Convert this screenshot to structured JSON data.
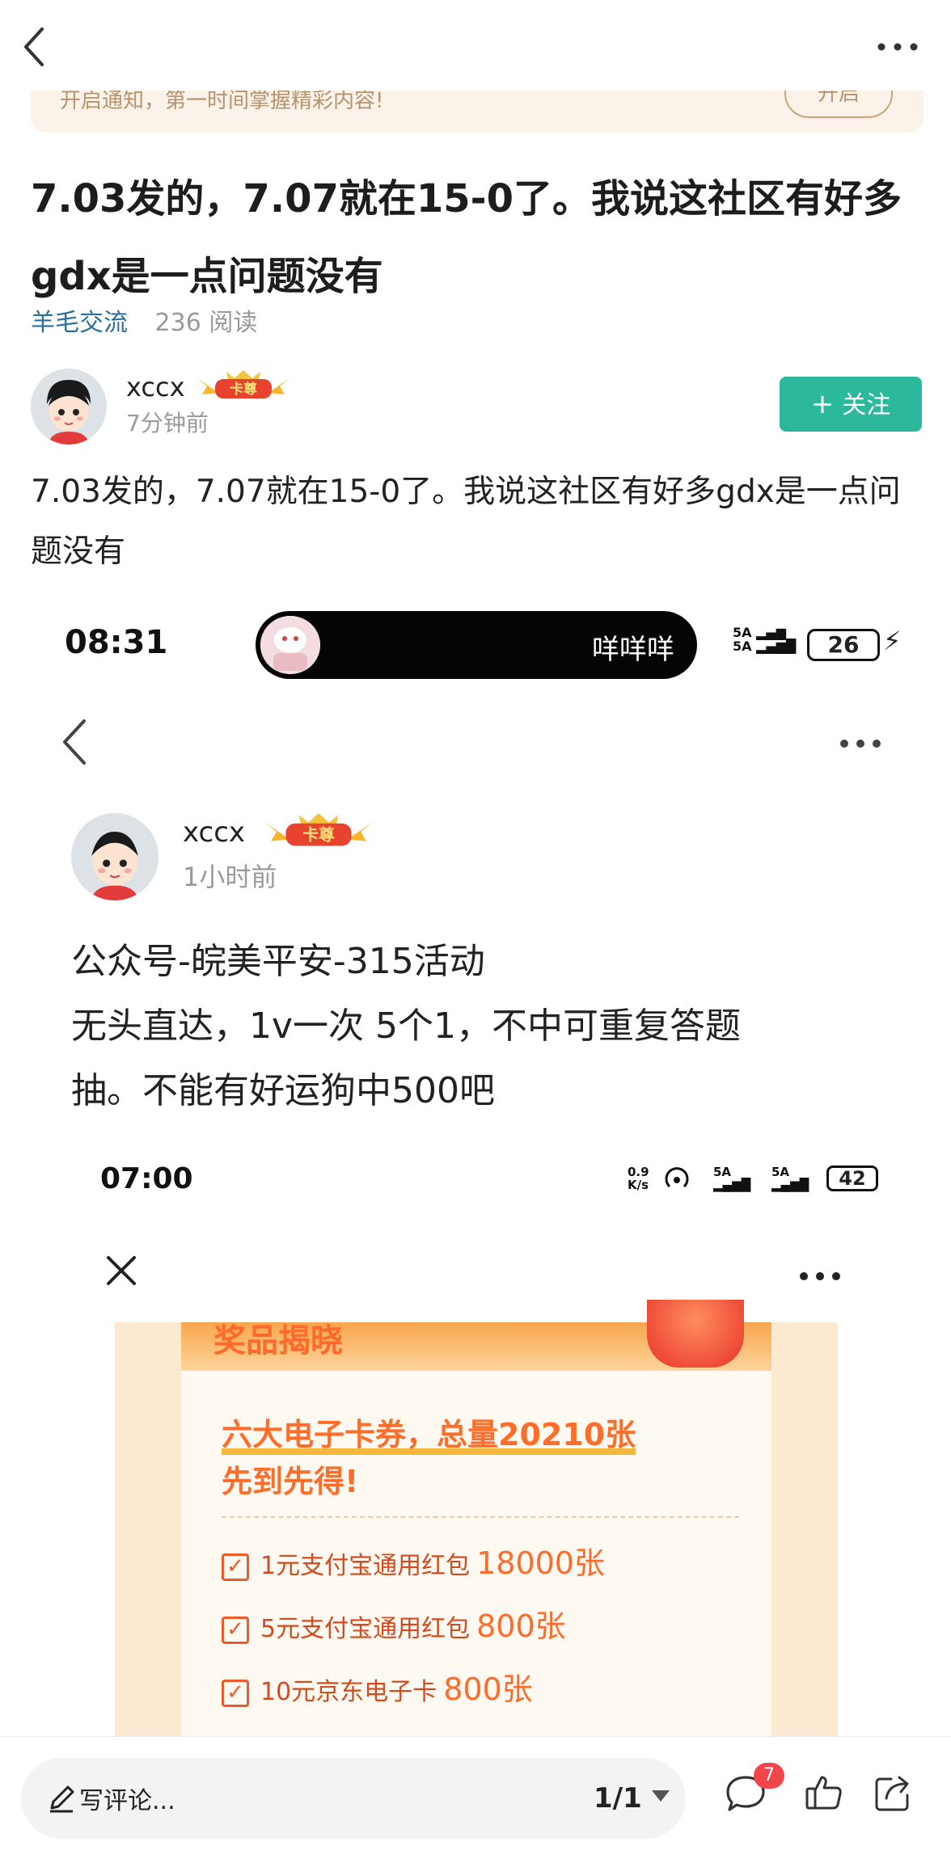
{
  "nav": {
    "back_icon": "back-arrow-icon",
    "more_icon": "more-dots-icon"
  },
  "notify": {
    "text": "开启通知，第一时间掌握精彩内容!",
    "button": "开启"
  },
  "post": {
    "title": "7.03发的，7.07就在15-0了。我说这社区有好多gdx是一点问题没有",
    "category": "羊毛交流",
    "reads": "236 阅读",
    "author": {
      "name": "xccx",
      "badge": "卡尊",
      "time": "7分钟前"
    },
    "follow": {
      "label": "关注",
      "plus": "+"
    },
    "body": "7.03发的，7.07就在15-0了。我说这社区有好多gdx是一点问题没有"
  },
  "shot": {
    "status": {
      "time": "08:31",
      "live_text": "咩咩咩",
      "signal_top": "5A",
      "signal_bottom": "5A",
      "battery": "26",
      "charging": "⚡"
    },
    "author": {
      "name": "xccx",
      "badge": "卡尊",
      "time": "1小时前"
    },
    "body_lines": [
      "公众号-皖美平安-315活动",
      "无头直达，1v一次  5个1，不中可重复答题",
      "抽。不能有好运狗中500吧"
    ],
    "inner": {
      "time": "07:00",
      "speed_top": "0.9",
      "speed_bottom": "K/s",
      "sig1": "5A",
      "sig2": "5A",
      "battery": "42"
    },
    "promo": {
      "banner": "奖品揭晓",
      "headline_1": "六大电子卡券，总量20210张",
      "headline_2": "先到先得!",
      "items": [
        {
          "name": "1元支付宝通用红包",
          "qty": "18000张"
        },
        {
          "name": "5元支付宝通用红包",
          "qty": "800张"
        },
        {
          "name": "10元京东电子卡",
          "qty": "800张"
        }
      ]
    }
  },
  "bottom": {
    "comment_placeholder": "写评论...",
    "page": "1/1",
    "comment_count": "7"
  },
  "colors": {
    "accent_green": "#2cb89a",
    "link_blue": "#2c6e9c",
    "badge_red": "#f2454a",
    "promo_orange": "#ff6d2a"
  }
}
